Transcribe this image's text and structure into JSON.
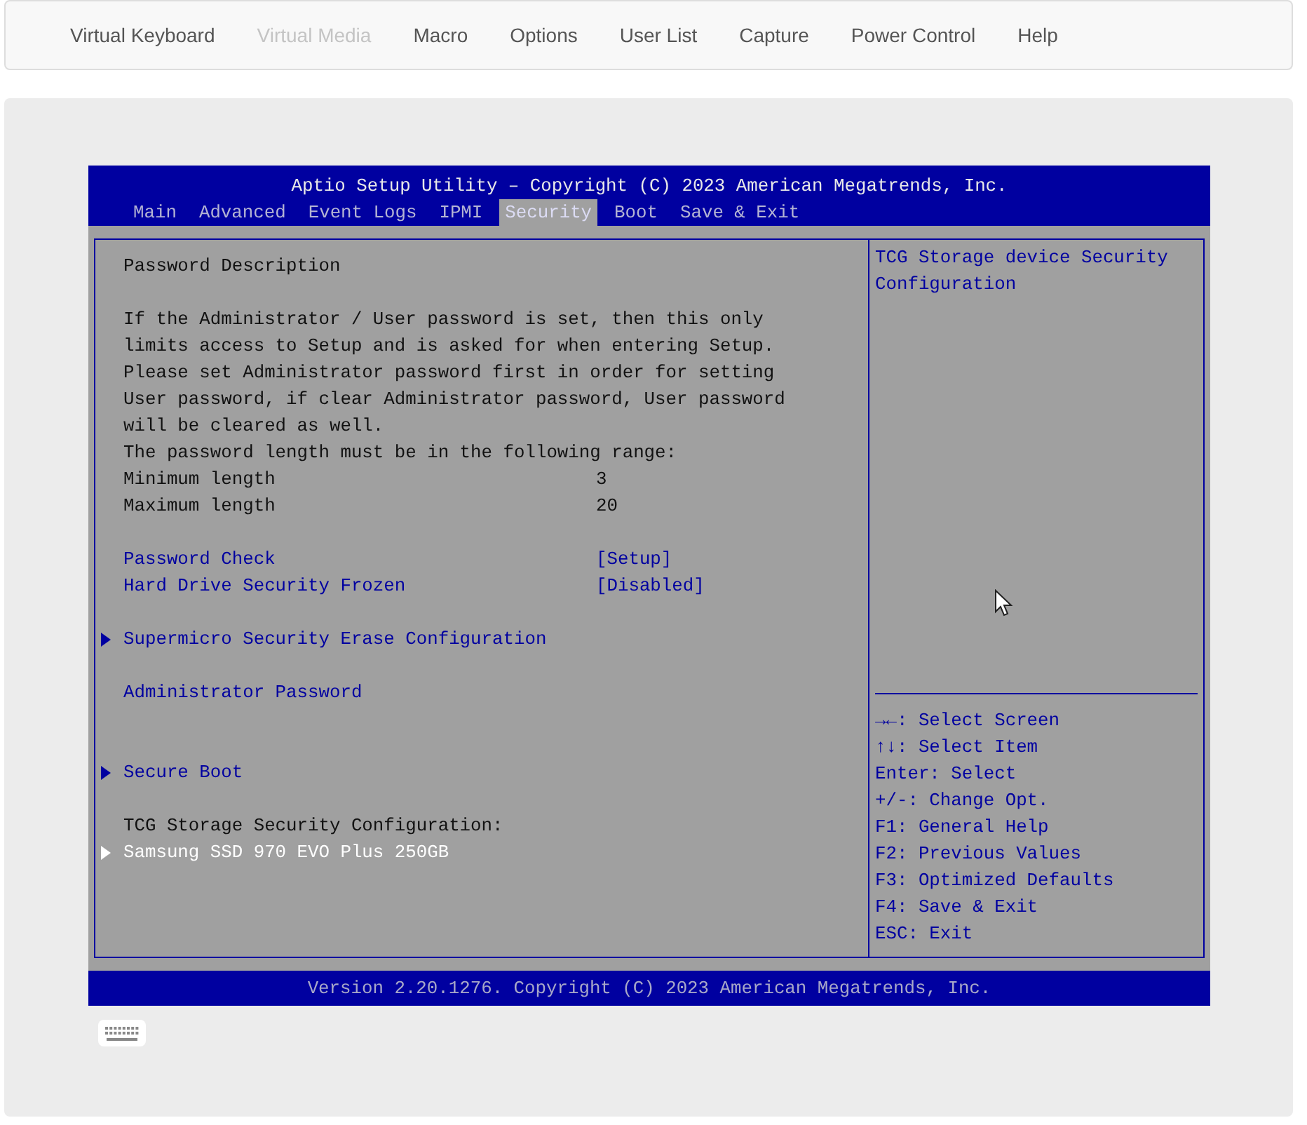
{
  "nav": {
    "items": [
      {
        "label": "Virtual Keyboard",
        "disabled": false
      },
      {
        "label": "Virtual Media",
        "disabled": true
      },
      {
        "label": "Macro",
        "disabled": false
      },
      {
        "label": "Options",
        "disabled": false
      },
      {
        "label": "User List",
        "disabled": false
      },
      {
        "label": "Capture",
        "disabled": false
      },
      {
        "label": "Power Control",
        "disabled": false
      },
      {
        "label": "Help",
        "disabled": false
      }
    ]
  },
  "bios": {
    "title": "Aptio Setup Utility – Copyright (C) 2023 American Megatrends, Inc.",
    "tabs": [
      {
        "label": "Main",
        "selected": false
      },
      {
        "label": "Advanced",
        "selected": false
      },
      {
        "label": "Event Logs",
        "selected": false
      },
      {
        "label": "IPMI",
        "selected": false
      },
      {
        "label": "Security",
        "selected": true
      },
      {
        "label": "Boot",
        "selected": false
      },
      {
        "label": "Save & Exit",
        "selected": false
      }
    ],
    "lines": [
      {
        "kind": "text",
        "text": "Password Description"
      },
      {
        "kind": "spacer"
      },
      {
        "kind": "text",
        "text": "If the Administrator / User password is set, then this only"
      },
      {
        "kind": "text",
        "text": "limits access to Setup and is asked for when entering Setup."
      },
      {
        "kind": "text",
        "text": "Please set Administrator password first in order for setting"
      },
      {
        "kind": "text",
        "text": "User password, if clear Administrator password, User password"
      },
      {
        "kind": "text",
        "text": "will be cleared as well."
      },
      {
        "kind": "text",
        "text": "The password length must be in the following range:"
      },
      {
        "kind": "info",
        "text": "Minimum length",
        "value": "3"
      },
      {
        "kind": "info",
        "text": "Maximum length",
        "value": "20"
      },
      {
        "kind": "spacer"
      },
      {
        "kind": "setting",
        "text": "Password Check",
        "value": "[Setup]",
        "selected": false
      },
      {
        "kind": "setting",
        "text": "Hard Drive Security Frozen",
        "value": "[Disabled]",
        "selected": false
      },
      {
        "kind": "spacer"
      },
      {
        "kind": "submenu",
        "text": "Supermicro Security Erase Configuration",
        "selected": false
      },
      {
        "kind": "spacer"
      },
      {
        "kind": "setting",
        "text": "Administrator Password",
        "selected": false
      },
      {
        "kind": "spacer"
      },
      {
        "kind": "spacer"
      },
      {
        "kind": "submenu",
        "text": "Secure Boot",
        "selected": false
      },
      {
        "kind": "spacer"
      },
      {
        "kind": "text",
        "text": "TCG Storage Security Configuration:"
      },
      {
        "kind": "submenu",
        "text": "Samsung SSD 970 EVO Plus 250GB",
        "selected": true
      }
    ],
    "help": [
      "TCG Storage device Security",
      "Configuration"
    ],
    "keys": [
      "→←: Select Screen",
      "↑↓: Select Item",
      "Enter: Select",
      "+/-: Change Opt.",
      "F1: General Help",
      "F2: Previous Values",
      "F3: Optimized Defaults",
      "F4: Save & Exit",
      "ESC: Exit"
    ],
    "footer": "Version 2.20.1276. Copyright (C) 2023 American Megatrends, Inc."
  }
}
